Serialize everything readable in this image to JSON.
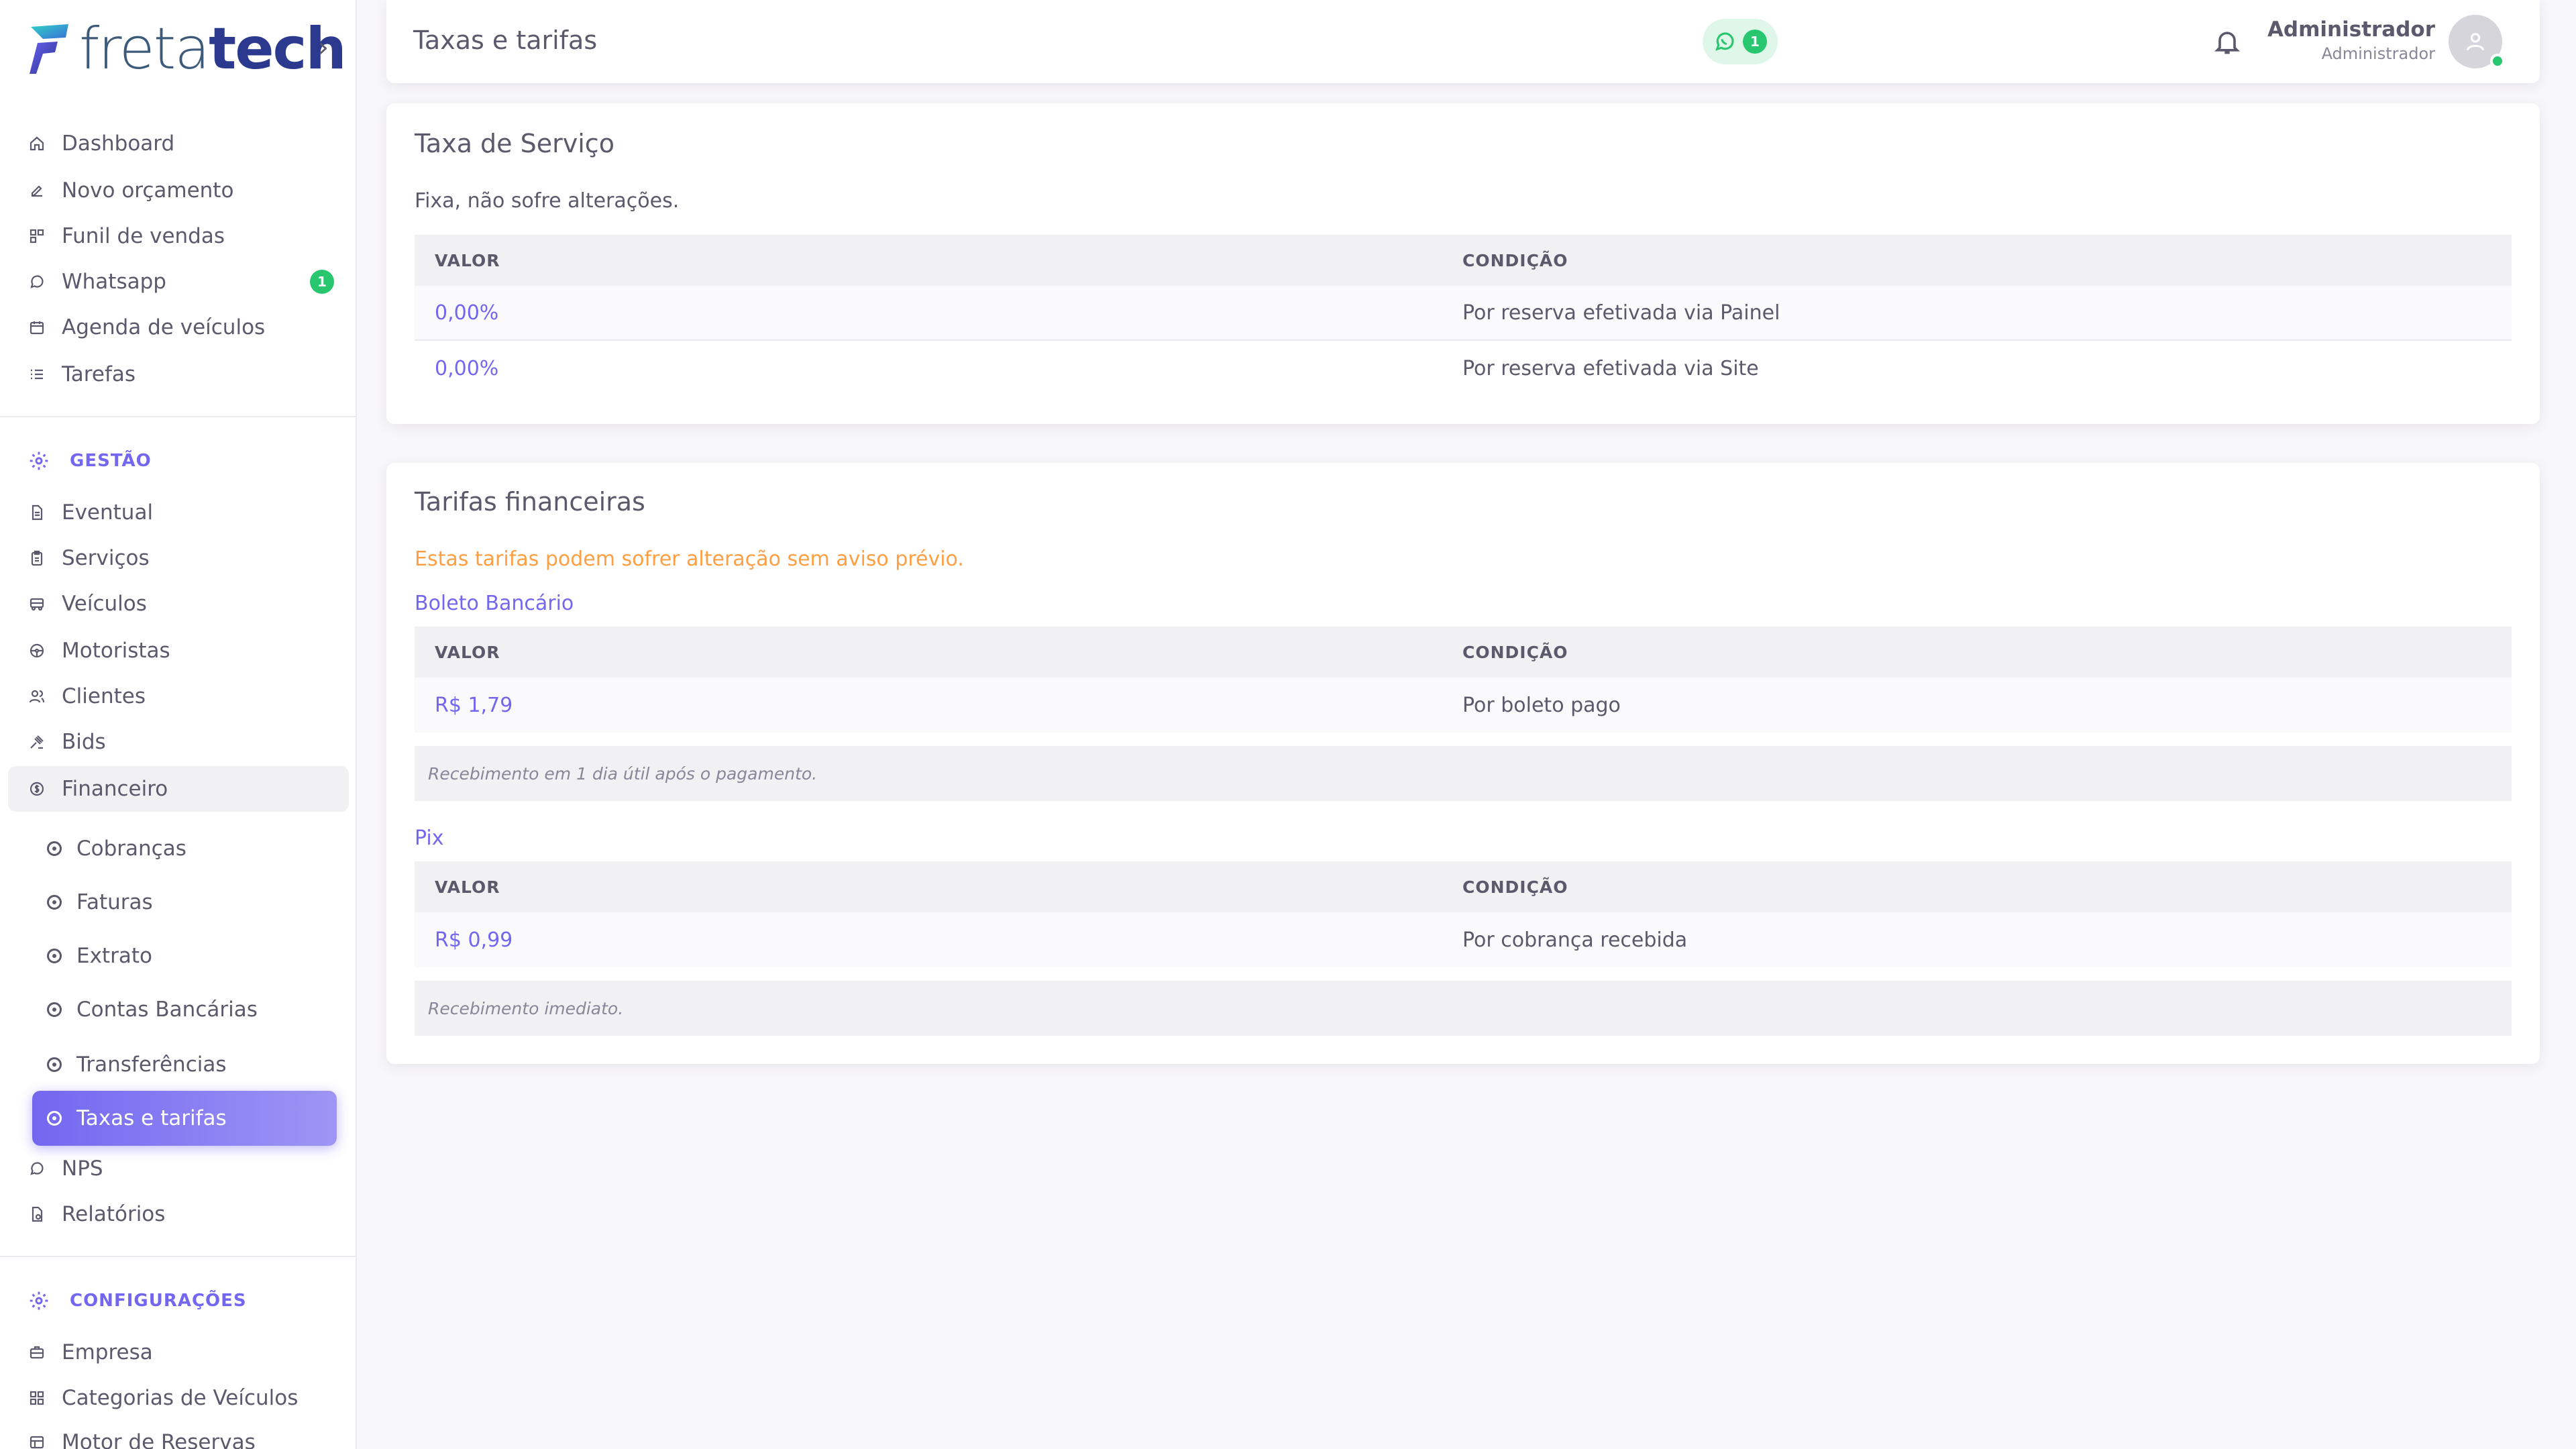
{
  "brand": {
    "part1": "freta",
    "part2": "tech"
  },
  "sidebar": {
    "main_items": [
      {
        "label": "Dashboard",
        "icon": "home-icon"
      },
      {
        "label": "Novo orçamento",
        "icon": "edit-icon"
      },
      {
        "label": "Funil de vendas",
        "icon": "funnel-icon"
      },
      {
        "label": "Whatsapp",
        "icon": "whatsapp-icon",
        "badge": "1"
      },
      {
        "label": "Agenda de veículos",
        "icon": "calendar-icon"
      },
      {
        "label": "Tarefas",
        "icon": "list-icon"
      }
    ],
    "gestao_title": "GESTÃO",
    "gestao_items": [
      {
        "label": "Eventual",
        "icon": "file-icon"
      },
      {
        "label": "Serviços",
        "icon": "clipboard-icon"
      },
      {
        "label": "Veículos",
        "icon": "bus-icon"
      },
      {
        "label": "Motoristas",
        "icon": "steering-wheel-icon"
      },
      {
        "label": "Clientes",
        "icon": "users-icon"
      },
      {
        "label": "Bids",
        "icon": "gavel-icon"
      },
      {
        "label": "Financeiro",
        "icon": "coin-icon"
      }
    ],
    "financeiro_items": [
      {
        "label": "Cobranças"
      },
      {
        "label": "Faturas"
      },
      {
        "label": "Extrato"
      },
      {
        "label": "Contas Bancárias"
      },
      {
        "label": "Transferências"
      },
      {
        "label": "Taxas e tarifas"
      }
    ],
    "after_items": [
      {
        "label": "NPS",
        "icon": "message-icon"
      },
      {
        "label": "Relatórios",
        "icon": "report-icon"
      }
    ],
    "config_title": "CONFIGURAÇÕES",
    "config_items": [
      {
        "label": "Empresa",
        "icon": "briefcase-icon"
      },
      {
        "label": "Categorias de Veículos",
        "icon": "category-icon"
      },
      {
        "label": "Motor de Reservas",
        "icon": "table-icon"
      }
    ]
  },
  "navbar": {
    "title": "Taxas e tarifas",
    "whatsapp_badge": "1",
    "user_name": "Administrador",
    "user_role": "Administrador"
  },
  "service_fee": {
    "title": "Taxa de Serviço",
    "subtitle": "Fixa, não sofre alterações.",
    "col_value": "VALOR",
    "col_condition": "CONDIÇÃO",
    "rows": [
      {
        "value": "0,00%",
        "condition": "Por reserva efetivada via Painel"
      },
      {
        "value": "0,00%",
        "condition": "Por reserva efetivada via Site"
      }
    ]
  },
  "financial": {
    "title": "Tarifas financeiras",
    "warning": "Estas tarifas podem sofrer alteração sem aviso prévio.",
    "boleto": {
      "title": "Boleto Bancário",
      "col_value": "VALOR",
      "col_condition": "CONDIÇÃO",
      "value": "R$ 1,79",
      "condition": "Por boleto pago",
      "note": "Recebimento em 1 dia útil após o pagamento."
    },
    "pix": {
      "title": "Pix",
      "col_value": "VALOR",
      "col_condition": "CONDIÇÃO",
      "value": "R$ 0,99",
      "condition": "Por cobrança recebida",
      "note": "Recebimento imediato."
    }
  },
  "colors": {
    "primary": "#7367f0",
    "success": "#28c76f",
    "warning": "#ff9f43"
  }
}
